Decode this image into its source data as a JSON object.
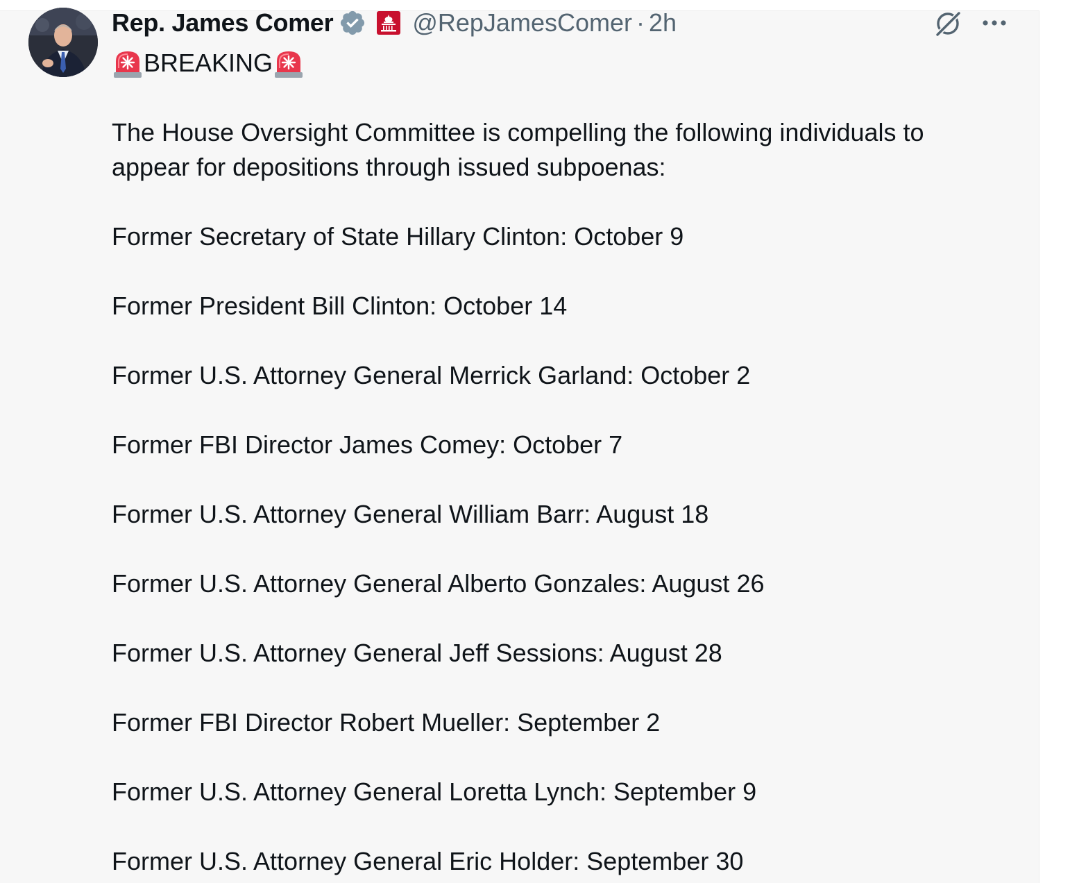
{
  "tweet": {
    "author": {
      "display_name": "Rep. James Comer",
      "handle": "@RepJamesComer",
      "separator": "·",
      "time": "2h",
      "verified_icon": "verified-badge-icon",
      "affiliation_icon": "capitol-icon",
      "colors": {
        "verified": "#829aab",
        "affiliation": "#c8102e"
      }
    },
    "actions": {
      "grok_icon": "grok-icon",
      "more_icon": "more-dots-icon"
    },
    "text": {
      "siren_icon": "police-light-emoji",
      "breaking": "BREAKING",
      "intro": "The House Oversight Committee is compelling the following individuals to appear for depositions through issued subpoenas:",
      "list": [
        "Former Secretary of State Hillary Clinton: October 9",
        "Former President Bill Clinton: October 14",
        "Former U.S. Attorney General Merrick Garland: October 2",
        "Former FBI Director James Comey: October 7",
        "Former U.S. Attorney General William Barr: August 18",
        "Former U.S. Attorney General Alberto Gonzales: August 26",
        "Former U.S. Attorney General Jeff Sessions: August 28",
        "Former FBI Director Robert Mueller: September 2",
        "Former U.S. Attorney General Loretta Lynch: September 9",
        "Former U.S. Attorney General Eric Holder: September 30"
      ]
    }
  }
}
